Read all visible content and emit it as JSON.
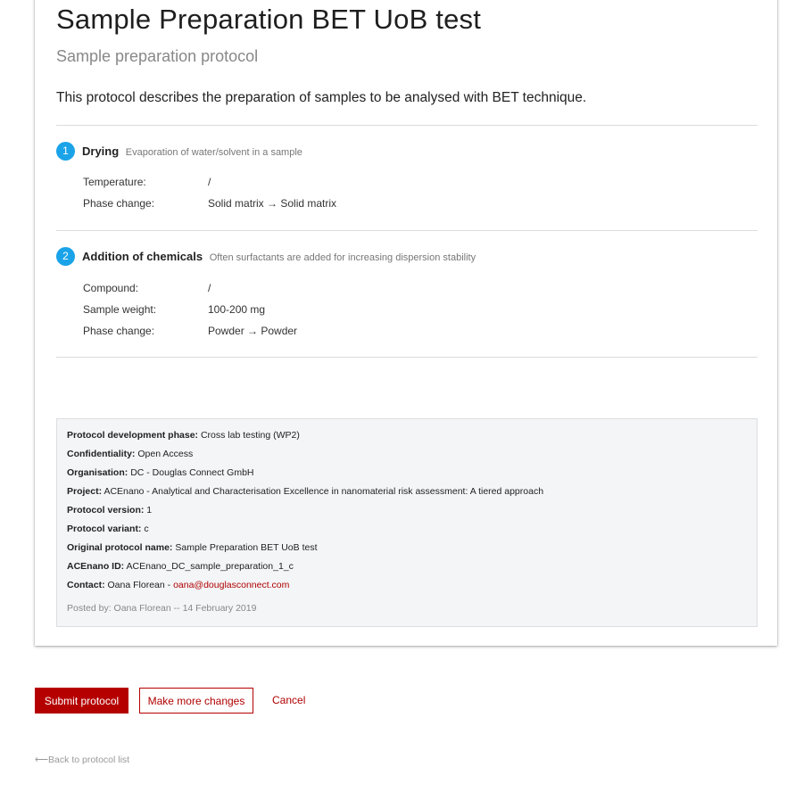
{
  "protocol": {
    "title": "Sample Preparation BET UoB test",
    "subtitle": "Sample preparation protocol",
    "description": "This protocol describes the preparation of samples to be analysed with BET technique."
  },
  "steps": [
    {
      "number": "1",
      "name": "Drying",
      "description": "Evaporation of water/solvent in a sample",
      "fields": [
        {
          "label": "Temperature:",
          "value": "/"
        },
        {
          "label": "Phase change:",
          "value": "Solid matrix → Solid matrix"
        }
      ]
    },
    {
      "number": "2",
      "name": "Addition of chemicals",
      "description": "Often surfactants are added for increasing dispersion stability",
      "fields": [
        {
          "label": "Compound:",
          "value": "/"
        },
        {
          "label": "Sample weight:",
          "value": "100-200 mg"
        },
        {
          "label": "Phase change:",
          "value": "Powder → Powder"
        }
      ]
    }
  ],
  "meta": {
    "rows": [
      {
        "label": "Protocol development phase:",
        "value": "Cross lab testing (WP2)"
      },
      {
        "label": "Confidentiality:",
        "value": "Open Access"
      },
      {
        "label": "Organisation:",
        "value": "DC - Douglas Connect GmbH"
      },
      {
        "label": "Project:",
        "value": "ACEnano - Analytical and Characterisation Excellence in nanomaterial risk assessment: A tiered approach"
      },
      {
        "label": "Protocol version:",
        "value": "1"
      },
      {
        "label": "Protocol variant:",
        "value": "c"
      },
      {
        "label": "Original protocol name:",
        "value": "Sample Preparation BET UoB test"
      },
      {
        "label": "ACEnano ID:",
        "value": "ACEnano_DC_sample_preparation_1_c"
      }
    ],
    "contact_label": "Contact:",
    "contact_name": "Oana Florean - ",
    "contact_email": "oana@douglasconnect.com",
    "posted": "Posted by: Oana Florean -- 14 February 2019"
  },
  "actions": {
    "submit": "Submit protocol",
    "changes": "Make more changes",
    "cancel": "Cancel",
    "back": "⟵Back to protocol list"
  },
  "colors": {
    "accent": "#b50000",
    "step_badge": "#1aa3e8"
  }
}
